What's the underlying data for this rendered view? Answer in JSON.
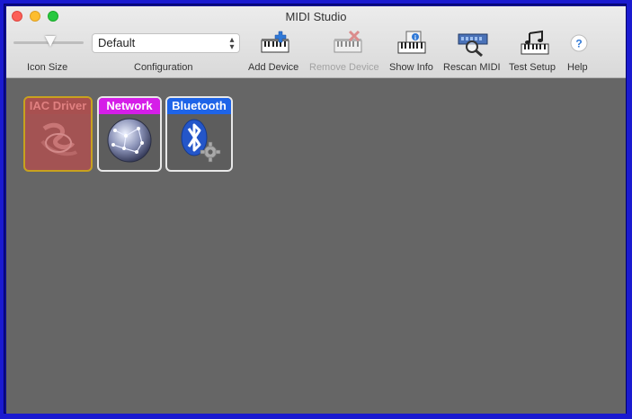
{
  "window": {
    "title": "MIDI Studio"
  },
  "toolbar": {
    "icon_size_label": "Icon Size",
    "icon_size_value": 0.5,
    "configuration_label": "Configuration",
    "configuration_value": "Default",
    "buttons": [
      {
        "label": "Add Device",
        "icon": "keyboard-plus-icon",
        "enabled": true
      },
      {
        "label": "Remove Device",
        "icon": "keyboard-remove-icon",
        "enabled": false
      },
      {
        "label": "Show Info",
        "icon": "keyboard-info-icon",
        "enabled": true
      },
      {
        "label": "Rescan MIDI",
        "icon": "rescan-magnifier-icon",
        "enabled": true
      },
      {
        "label": "Test Setup",
        "icon": "music-notes-keyboard-icon",
        "enabled": true
      },
      {
        "label": "Help",
        "icon": "help-icon",
        "enabled": true
      }
    ]
  },
  "devices": [
    {
      "name": "IAC Driver",
      "icon": "iac-driver-icon",
      "status": "offline",
      "accent": "#c8a21e"
    },
    {
      "name": "Network",
      "icon": "network-globe-icon",
      "status": "online",
      "accent": "#d51ee8"
    },
    {
      "name": "Bluetooth",
      "icon": "bluetooth-gear-icon",
      "status": "online",
      "accent": "#1e64e8"
    }
  ],
  "colors": {
    "close": "#fc5f57",
    "minimize": "#fdbd2e",
    "maximize": "#27c840",
    "canvas": "#666666",
    "desktop_border": "#1a1ad0"
  }
}
